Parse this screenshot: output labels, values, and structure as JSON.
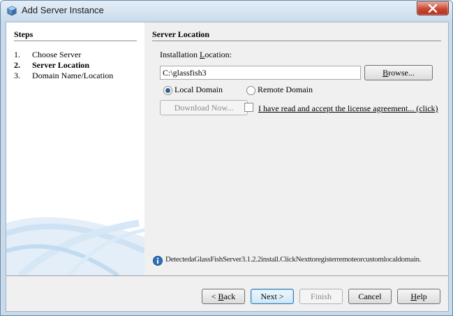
{
  "window": {
    "title": "Add Server Instance",
    "icon": "netbeans-cube-icon"
  },
  "steps": {
    "heading": "Steps",
    "items": [
      {
        "num": "1.",
        "label": "Choose Server"
      },
      {
        "num": "2.",
        "label": "Server Location"
      },
      {
        "num": "3.",
        "label": "Domain Name/Location"
      }
    ],
    "current_index": 1
  },
  "panel": {
    "heading": "Server Location",
    "install_label_prefix": "Installation ",
    "install_label_mnemonic": "L",
    "install_label_suffix": "ocation:",
    "install_value": "C:\\glassfish3",
    "browse_prefix": "",
    "browse_mnemonic": "B",
    "browse_suffix": "rowse...",
    "local_domain_label": "Local Domain",
    "local_domain_checked": true,
    "remote_domain_label": "Remote Domain",
    "remote_domain_checked": false,
    "download_label": "Download Now...",
    "license_label": "I have read and accept the license agreement... (click)",
    "license_checked": false,
    "info_message": "DetectedaGlassFishServer3.1.2.2install.ClickNexttoregisterremoteorcustomlocaldomain."
  },
  "buttons": {
    "back_prefix": "< ",
    "back_mnemonic": "B",
    "back_suffix": "ack",
    "next_label": "Next >",
    "finish_label": "Finish",
    "cancel_label": "Cancel",
    "help_label": "Help",
    "help_mnemonic": "H",
    "help_suffix": "elp"
  }
}
